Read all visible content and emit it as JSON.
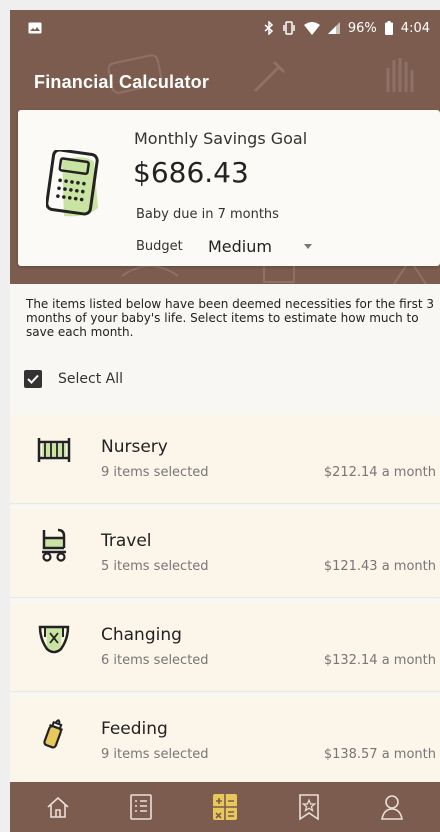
{
  "status_bar": {
    "battery": "96%",
    "time": "4:04",
    "icons": [
      "image-icon",
      "bluetooth-icon",
      "vibrate-icon",
      "wifi-icon",
      "signal-icon",
      "battery-icon"
    ]
  },
  "header": {
    "title": "Financial Calculator"
  },
  "goal_card": {
    "label": "Monthly Savings Goal",
    "amount": "$686.43",
    "due_text": "Baby due in 7 months",
    "budget_label": "Budget",
    "budget_value": "Medium",
    "icon": "calculator-icon"
  },
  "intro_text": "The items listed below have been deemed necessities for the first 3 months of your baby's life. Select items to estimate how much to save each month.",
  "select_all": {
    "label": "Select All",
    "checked": true
  },
  "categories": [
    {
      "name": "Nursery",
      "count": "9 items selected",
      "amount": "$212.14 a month",
      "icon": "crib-icon"
    },
    {
      "name": "Travel",
      "count": "5 items selected",
      "amount": "$121.43 a month",
      "icon": "stroller-icon"
    },
    {
      "name": "Changing",
      "count": "6 items selected",
      "amount": "$132.14 a month",
      "icon": "diaper-icon"
    },
    {
      "name": "Feeding",
      "count": "9 items selected",
      "amount": "$138.57 a month",
      "icon": "bottle-icon"
    }
  ],
  "bottom_nav": [
    {
      "name": "home",
      "icon": "home-icon",
      "active": false
    },
    {
      "name": "checklist",
      "icon": "checklist-icon",
      "active": false
    },
    {
      "name": "calculator",
      "icon": "calculator-nav-icon",
      "active": true
    },
    {
      "name": "favorites",
      "icon": "bookmark-star-icon",
      "active": false
    },
    {
      "name": "profile",
      "icon": "profile-icon",
      "active": false
    }
  ],
  "colors": {
    "brand_brown": "#7c5c4e",
    "accent_yellow": "#e8c75b",
    "accent_green": "#c9e3a3",
    "card_cream": "#fbf5ea"
  }
}
